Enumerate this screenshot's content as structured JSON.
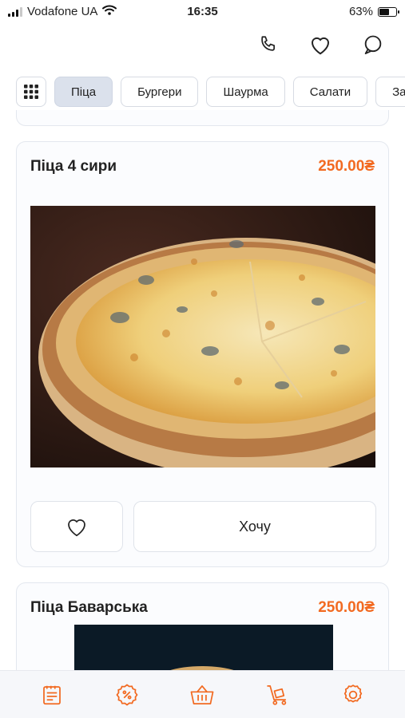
{
  "status_bar": {
    "carrier": "Vodafone UA",
    "time": "16:35",
    "battery": "63%",
    "battery_level": 0.63
  },
  "header": {
    "icons": [
      "phone-icon",
      "heart-icon",
      "chat-icon"
    ]
  },
  "categories": {
    "menu_icon": "grid-icon",
    "items": [
      {
        "label": "Піца",
        "active": true
      },
      {
        "label": "Бургери",
        "active": false
      },
      {
        "label": "Шаурма",
        "active": false
      },
      {
        "label": "Салати",
        "active": false
      },
      {
        "label": "Заку",
        "active": false
      }
    ]
  },
  "products": [
    {
      "title": "Піца 4 сири",
      "price": "250.00₴",
      "favorite_icon": "heart-icon",
      "action_label": "Хочу"
    },
    {
      "title": "Піца Баварська",
      "price": "250.00₴"
    }
  ],
  "tab_bar": {
    "icons": [
      "menu-icon",
      "discount-icon",
      "basket-icon",
      "delivery-icon",
      "settings-icon"
    ]
  },
  "colors": {
    "accent": "#f26a21",
    "active_chip": "#dbe1ec",
    "card_border": "#e3e7ee"
  }
}
